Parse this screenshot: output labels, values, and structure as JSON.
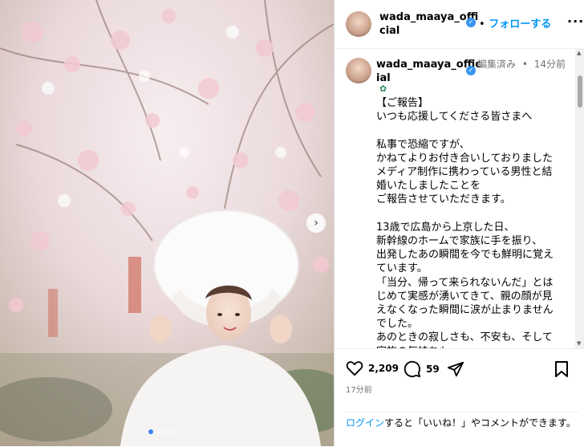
{
  "post": {
    "username": "wada_maaya_official",
    "username_line1": "wada_maaya_offi",
    "username_line2": "cial",
    "follow_sep": "•",
    "follow_label": "フォローする",
    "comment_username_line1": "wada_maaya_offic",
    "comment_username_line2": "ial",
    "edited_label": "編集済み",
    "time_sep": "•",
    "comment_time": "14分前",
    "caption": "【ご報告】\nいつも応援してくださる皆さまへ\n\n私事で恐縮ですが、\nかねてよりお付き合いしておりました\nメディア制作に携わっている男性と結婚いたしましたことを\nご報告させていただきます。\n\n13歳で広島から上京した日、\n新幹線のホームで家族に手を振り、\n出発したあの瞬間を今でも鮮明に覚えています。\n「当分、帰って来られないんだ」とはじめて実感が湧いてきて、親の顔が見えなくなった瞬間に涙が止まりませんでした。\nあのときの寂しさも、不安も、そして家族の気持ちも、",
    "likes": "2,209",
    "comments": "59",
    "post_time": "17分前",
    "login_link": "ログイン",
    "login_text": "すると「いいね！」やコメントができます。"
  },
  "icons": {
    "next": "chevron-right-icon",
    "verified": "verified-badge-icon",
    "like": "heart-icon",
    "comment": "comment-icon",
    "share": "send-icon",
    "save": "bookmark-icon",
    "more": "more-dots-icon"
  },
  "carousel": {
    "total": 4,
    "current": 1
  }
}
